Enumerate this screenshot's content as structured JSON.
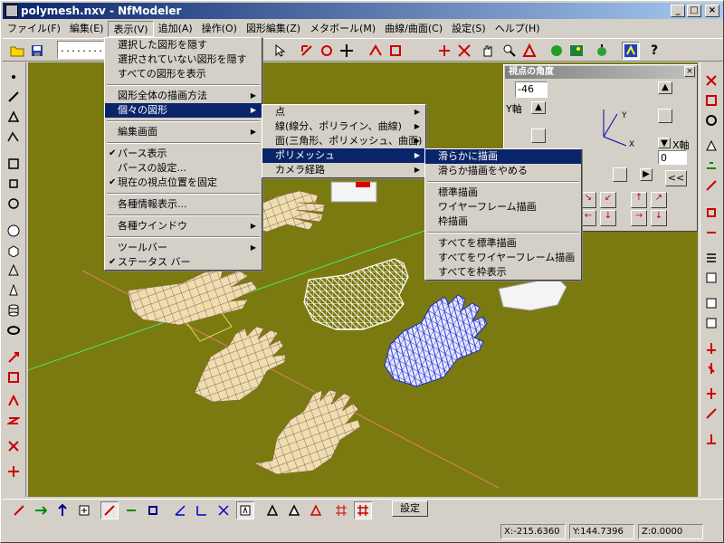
{
  "window": {
    "title": "polymesh.nxv - NfModeler",
    "controls": [
      "_",
      "□",
      "×"
    ]
  },
  "menubar": {
    "items": [
      "ファイル(F)",
      "編集(E)",
      "表示(V)",
      "追加(A)",
      "操作(O)",
      "図形編集(Z)",
      "メタボール(M)",
      "曲線/曲面(C)",
      "設定(S)",
      "ヘルプ(H)"
    ],
    "open_index": 2
  },
  "toolbar": {
    "combo_value": "........"
  },
  "view_menu": {
    "items": [
      {
        "label": "選択した図形を隠す"
      },
      {
        "label": "選択されていない図形を隠す"
      },
      {
        "label": "すべての図形を表示"
      },
      {
        "sep": true
      },
      {
        "label": "図形全体の描画方法",
        "arrow": true
      },
      {
        "label": "個々の図形",
        "arrow": true,
        "hl": true
      },
      {
        "sep": true
      },
      {
        "label": "編集画面",
        "arrow": true
      },
      {
        "sep": true
      },
      {
        "label": "パース表示",
        "check": true
      },
      {
        "label": "パースの設定..."
      },
      {
        "label": "現在の視点位置を固定",
        "check": true
      },
      {
        "sep": true
      },
      {
        "label": "各種情報表示..."
      },
      {
        "sep": true
      },
      {
        "label": "各種ウインドウ",
        "arrow": true
      },
      {
        "sep": true
      },
      {
        "label": "ツールバー",
        "arrow": true
      },
      {
        "label": "ステータス バー",
        "check": true
      }
    ]
  },
  "shape_menu": {
    "items": [
      {
        "label": "点",
        "arrow": true
      },
      {
        "label": "線(線分、ポリライン、曲線)",
        "arrow": true
      },
      {
        "label": "面(三角形、ポリメッシュ、曲面)",
        "arrow": true
      },
      {
        "label": "ポリメッシュ",
        "arrow": true,
        "hl": true
      },
      {
        "label": "カメラ経路",
        "arrow": true
      }
    ]
  },
  "polymesh_menu": {
    "items": [
      {
        "label": "滑らかに描画",
        "hl": true
      },
      {
        "label": "滑らか描画をやめる"
      },
      {
        "sep": true
      },
      {
        "label": "標準描画"
      },
      {
        "label": "ワイヤーフレーム描画"
      },
      {
        "label": "枠描画"
      },
      {
        "sep": true
      },
      {
        "label": "すべてを標準描画"
      },
      {
        "label": "すべてをワイヤーフレーム描画"
      },
      {
        "label": "すべてを枠表示"
      }
    ]
  },
  "view_panel": {
    "title": "視点の角度",
    "angle_value": "-46",
    "y_axis_label": "Y軸",
    "x_axis_label": "X軸",
    "x_value": "0",
    "collapse_label": "<<",
    "gizmo_y": "Y",
    "gizmo_x": "X"
  },
  "bottom_toolbar": {
    "settings_label": "設定"
  },
  "statusbar": {
    "x": "X:-215.6360",
    "y": "Y:144.7396",
    "z": "Z:0.0000"
  },
  "colors": {
    "viewport_bg": "#7b7a10",
    "title_start": "#0a246a",
    "menu_highlight": "#0a246a",
    "wire_blue": "#2233cc",
    "hand_tan": "#e8d5a8"
  }
}
